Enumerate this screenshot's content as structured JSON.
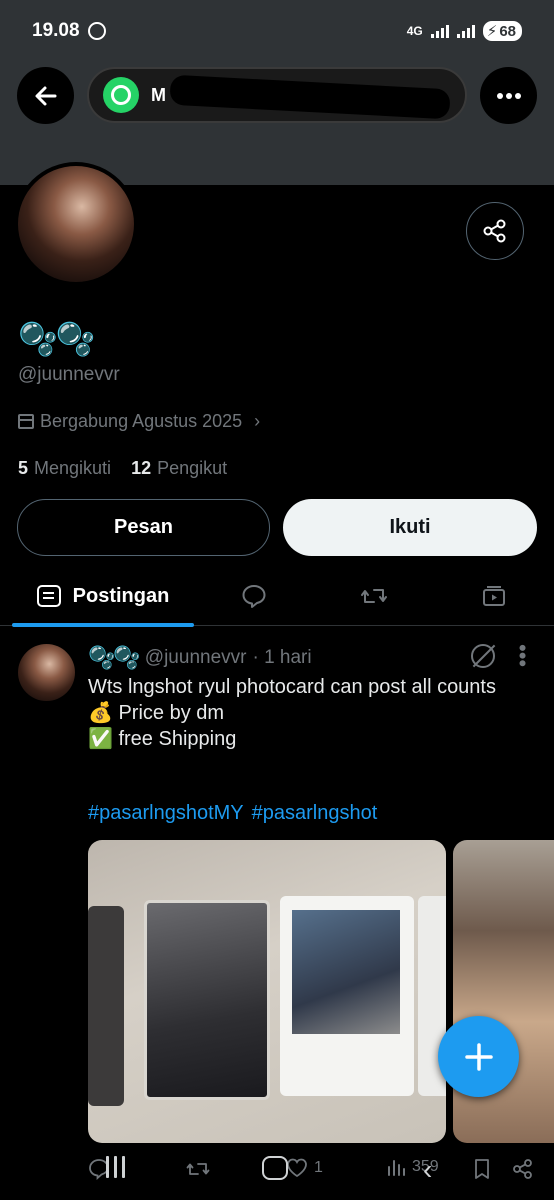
{
  "status": {
    "time": "19.08",
    "network": "4G",
    "battery": "68"
  },
  "header": {
    "back_icon": "arrow-left-icon",
    "app_chip_text": "M",
    "more_icon": "more-horizontal-icon"
  },
  "profile": {
    "display_name": "🫧🫧",
    "handle": "@juunnevvr",
    "joined": "Bergabung Agustus 2025",
    "following_count": "5",
    "following_label": "Mengikuti",
    "followers_count": "12",
    "followers_label": "Pengikut",
    "message_button": "Pesan",
    "follow_button": "Ikuti"
  },
  "tabs": {
    "posts_label": "Postingan"
  },
  "post": {
    "author_name": "🫧🫧",
    "handle": "@juunnevvr",
    "time": "· 1 hari",
    "text": "Wts lngshot ryul photocard can post all counts\n💰 Price by dm\n✅ free Shipping",
    "hashtags": [
      "#pasarlngshotMY",
      "#pasarlngshot"
    ],
    "like_count": "1",
    "view_count": "359"
  },
  "colors": {
    "accent": "#1d9bf0",
    "background": "#000000",
    "muted": "#71767b"
  }
}
